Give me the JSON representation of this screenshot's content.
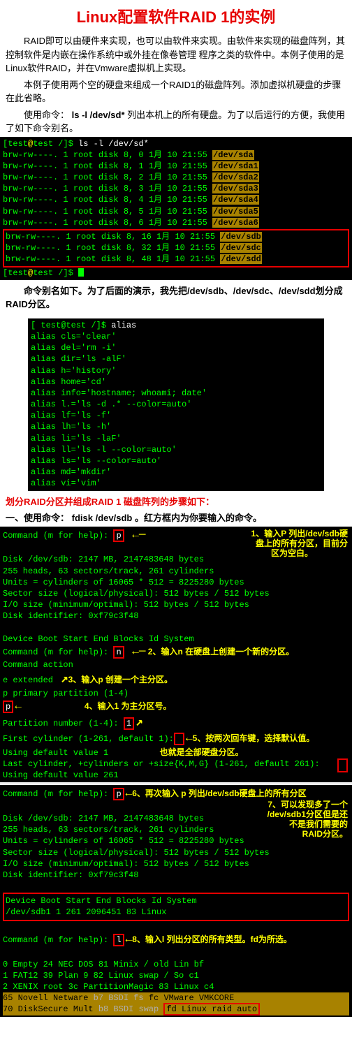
{
  "title": "Linux配置软件RAID 1的实例",
  "p1": "RAID即可以由硬件来实现，也可以由软件来实现。由软件来实现的磁盘阵列，其控制软件是内嵌在操作系统中或外挂在像卷管理 程序之类的软件中。本例子使用的是Linux软件RAID，并在Vmware虚拟机上实现。",
  "p2": "本例子使用两个空的硬盘来组成一个RAID1的磁盘阵列。添加虚拟机硬盘的步骤在此省略。",
  "p3_a": "使用命令：",
  "p3_cmd": "ls  -l  /dev/sd*",
  "p3_b": " 列出本机上的所有硬盘。为了以后运行的方便，我使用了如下命令别名。",
  "prompt1_a": "[",
  "prompt1_b": "test@test /",
  "prompt1_c": "]$ ",
  "cmd1": "ls -l /dev/sd*",
  "ls_rows": [
    {
      "perm": "brw-rw----.",
      "n": "1",
      "u": "root",
      "g": "disk",
      "maj": "8,",
      "min": "0",
      "mon": "1月",
      "day": "10",
      "time": "21:55",
      "dev": "/dev/sda"
    },
    {
      "perm": "brw-rw----.",
      "n": "1",
      "u": "root",
      "g": "disk",
      "maj": "8,",
      "min": "1",
      "mon": "1月",
      "day": "10",
      "time": "21:55",
      "dev": "/dev/sda1"
    },
    {
      "perm": "brw-rw----.",
      "n": "1",
      "u": "root",
      "g": "disk",
      "maj": "8,",
      "min": "2",
      "mon": "1月",
      "day": "10",
      "time": "21:55",
      "dev": "/dev/sda2"
    },
    {
      "perm": "brw-rw----.",
      "n": "1",
      "u": "root",
      "g": "disk",
      "maj": "8,",
      "min": "3",
      "mon": "1月",
      "day": "10",
      "time": "21:55",
      "dev": "/dev/sda3"
    },
    {
      "perm": "brw-rw----.",
      "n": "1",
      "u": "root",
      "g": "disk",
      "maj": "8,",
      "min": "4",
      "mon": "1月",
      "day": "10",
      "time": "21:55",
      "dev": "/dev/sda4"
    },
    {
      "perm": "brw-rw----.",
      "n": "1",
      "u": "root",
      "g": "disk",
      "maj": "8,",
      "min": "5",
      "mon": "1月",
      "day": "10",
      "time": "21:55",
      "dev": "/dev/sda5"
    },
    {
      "perm": "brw-rw----.",
      "n": "1",
      "u": "root",
      "g": "disk",
      "maj": "8,",
      "min": "6",
      "mon": "1月",
      "day": "10",
      "time": "21:55",
      "dev": "/dev/sda6"
    }
  ],
  "ls_rows_boxed": [
    {
      "perm": "brw-rw----.",
      "n": "1",
      "u": "root",
      "g": "disk",
      "maj": "8,",
      "min": "16",
      "mon": "1月",
      "day": "10",
      "time": "21:55",
      "dev": "/dev/sdb"
    },
    {
      "perm": "brw-rw----.",
      "n": "1",
      "u": "root",
      "g": "disk",
      "maj": "8,",
      "min": "32",
      "mon": "1月",
      "day": "10",
      "time": "21:55",
      "dev": "/dev/sdc"
    },
    {
      "perm": "brw-rw----.",
      "n": "1",
      "u": "root",
      "g": "disk",
      "maj": "8,",
      "min": "48",
      "mon": "1月",
      "day": "10",
      "time": "21:55",
      "dev": "/dev/sdd"
    }
  ],
  "prompt2": "[test@test /]$ ",
  "sub1_a": "命令别名如下。为了后面的演示，我先把",
  "sub1_b": "/dev/sdb",
  "sub1_c": "、",
  "sub1_d": "/dev/sdc",
  "sub1_e": "、",
  "sub1_f": "/dev/sdd",
  "sub1_g": "划分成RAID分区。",
  "alias_prompt": "[ test@test /]$ ",
  "alias_cmd": "alias",
  "aliases": [
    "alias cls='clear'",
    "alias del='rm -i'",
    "alias dir='ls -alF'",
    "alias h='history'",
    "alias home='cd'",
    "alias info='hostname; whoami; date'",
    "alias l.='ls -d .* --color=auto'",
    "alias lf='ls -f'",
    "alias lh='ls -h'",
    "alias li='ls -laF'",
    "alias ll='ls -l --color=auto'",
    "alias ls='ls --color=auto'",
    "alias md='mkdir'",
    "alias vi='vim'"
  ],
  "red_sec": "划分RAID分区并组成RAID 1 磁盘阵列的步骤如下：",
  "step1_a": "一、使用命令：",
  "step1_cmd": "fdisk  /dev/sdb",
  "step1_b": "。红方框内为你要输入的命令。",
  "fd": {
    "cmd_help": "Command (m for help): ",
    "p": "p",
    "disk_line": "Disk /dev/sdb: 2147 MB, 2147483648 bytes",
    "heads": "255 heads, 63 sectors/track, 261 cylinders",
    "units": "Units = cylinders of 16065 * 512 = 8225280 bytes",
    "sector": "Sector size (logical/physical): 512 bytes / 512 bytes",
    "io": "I/O size (minimum/optimal): 512 bytes / 512 bytes",
    "diskid": "Disk identifier: 0xf79c3f48",
    "tbl_head": "   Device Boot      Start         End      Blocks   Id  System",
    "n": "n",
    "cmd_action": "Command action",
    "ext": "   e   extended",
    "prim": "   p   primary partition (1-4)",
    "partnum": "Partition number (1-4): ",
    "one": "1",
    "firstcyl": "First cylinder (1-261, default 1):",
    "usedef1": "Using default value 1",
    "lastcyl": "Last cylinder, +cylinders or +size{K,M,G} (1-261, default 261):",
    "usedef261": "Using default value 261",
    "row_sdb1": "/dev/sdb1               1         261     2096451   83  Linux",
    "l": "l",
    "types": [
      " 0  Empty           24  NEC DOS         81  Minix / old Lin bf",
      " 1  FAT12           39  Plan 9          82  Linux swap / So c1",
      " 2  XENIX root      3c  PartitionMagic  83  Linux           c4"
    ],
    "types_hl": [
      "65  Novell Netware  b7  BSDI fs         fc  VMware VMKCORE",
      "70  DiskSecure Mult b8  BSDI swap       fd  Linux raid auto"
    ]
  },
  "ann": {
    "a1a": "1、输入P 列出/dev/sdb硬",
    "a1b": "盘上的所有分区，目前分",
    "a1c": "区为空白。",
    "a2": "2、输入n 在硬盘上创建一个新的分区。",
    "a3": "3、输入p 创建一个主分区。",
    "a4": "4、输入1 为主分区号。",
    "a5a": "5、按两次回车键，选择默认值。",
    "a5b": "也就是全部硬盘分区。",
    "a6": "6、再次输入 p 列出/dev/sdb硬盘上的所有分区",
    "a7a": "7、可以发现多了一个",
    "a7b": "/dev/sdb1分区但是还",
    "a7c": "不是我们需要的",
    "a7d": "RAID分区。",
    "a8": "8、输入l 列出分区的所有类型。fd为所选。"
  }
}
